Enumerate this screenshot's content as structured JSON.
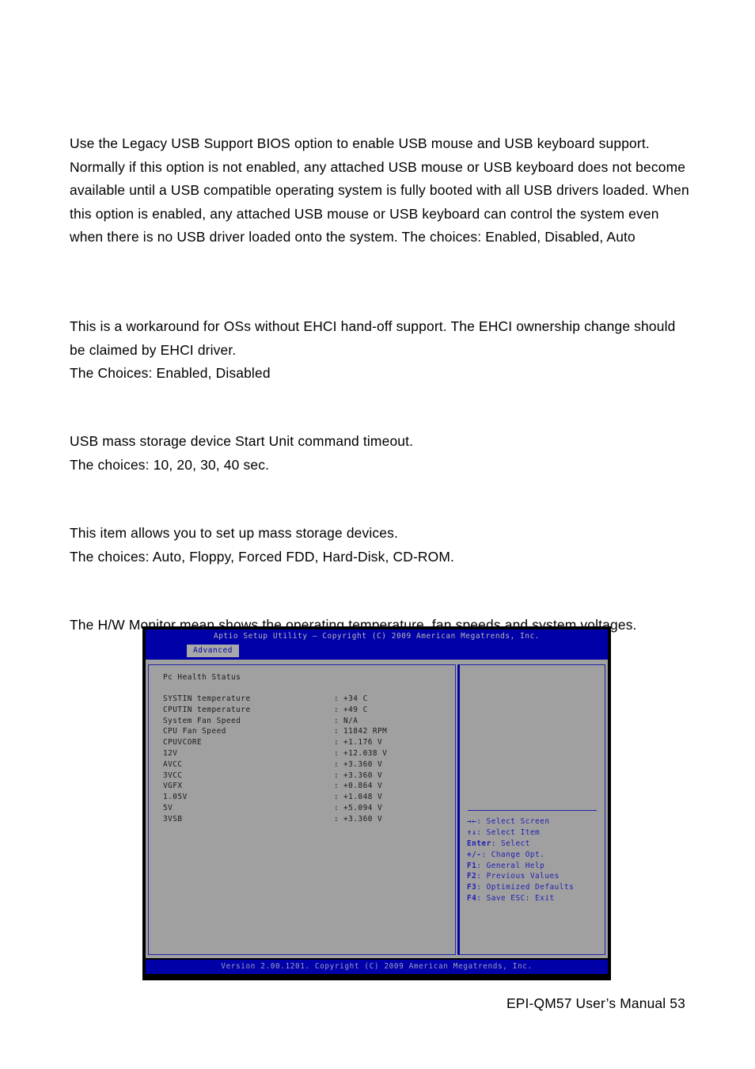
{
  "document": {
    "footer_text": "EPI-QM57  User’s  Manual 53",
    "page_number": "53"
  },
  "paragraphs": {
    "legacy_usb": "Use the Legacy USB Support BIOS option to enable USB mouse and USB keyboard support. Normally if this option is not enabled, any attached USB mouse or USB keyboard does not become available until a USB compatible operating system is fully booted with all USB drivers loaded. When this option is enabled, any attached USB mouse or USB keyboard can control the system even when there is no USB driver loaded onto the system. The choices: Enabled, Disabled, Auto",
    "ehci_handoff": "This is a workaround for OSs without EHCI hand-off support. The EHCI ownership change should be claimed by EHCI driver.\nThe Choices: Enabled, Disabled",
    "mass_storage_timeout": "USB mass storage device Start Unit command timeout.\nThe choices: 10, 20, 30, 40 sec.",
    "mass_storage_setup": "This item allows you to set up mass storage devices.\nThe choices: Auto, Floppy, Forced FDD, Hard-Disk, CD-ROM.",
    "hw_monitor": "The H/W Monitor mean shows the operating temperature, fan speeds and system voltages."
  },
  "bios": {
    "title": "Aptio Setup Utility – Copyright (C) 2009 American Megatrends, Inc.",
    "active_tab": "Advanced",
    "section_title": "Pc Health Status",
    "footer": "Version 2.00.1201. Copyright (C) 2009 American Megatrends, Inc.",
    "colors": {
      "header_blue": "#0000a8",
      "panel_gray": "#a0a0a0",
      "border_blue": "#2020a8",
      "help_text_blue": "#2020b4",
      "header_text": "#b9b9b9"
    },
    "items": [
      {
        "label": "SYSTIN temperature",
        "sep": ":",
        "value": "+34 C"
      },
      {
        "label": "CPUTIN temperature",
        "sep": ":",
        "value": "+49 C"
      },
      {
        "label": "System Fan Speed",
        "sep": ":",
        "value": "N/A"
      },
      {
        "label": "CPU Fan Speed",
        "sep": ":",
        "value": "11842 RPM"
      },
      {
        "label": "CPUVCORE",
        "sep": ":",
        "value": "+1.176 V"
      },
      {
        "label": "12V",
        "sep": ":",
        "value": "+12.038 V"
      },
      {
        "label": "AVCC",
        "sep": ":",
        "value": "+3.360 V"
      },
      {
        "label": "3VCC",
        "sep": ":",
        "value": "+3.360 V"
      },
      {
        "label": "VGFX",
        "sep": ":",
        "value": "+0.864 V"
      },
      {
        "label": "1.05V",
        "sep": ":",
        "value": "+1.048 V"
      },
      {
        "label": "5V",
        "sep": ":",
        "value": "+5.094 V"
      },
      {
        "label": "3VSB",
        "sep": ":",
        "value": "+3.360 V"
      }
    ],
    "help": [
      {
        "key": "→←",
        "text": ": Select Screen"
      },
      {
        "key": "↑↓",
        "text": ": Select Item"
      },
      {
        "key": "Enter",
        "text": ": Select"
      },
      {
        "key": "+/-",
        "text": ": Change Opt."
      },
      {
        "key": "F1",
        "text": ": General Help"
      },
      {
        "key": "F2",
        "text": ": Previous Values"
      },
      {
        "key": "F3",
        "text": ": Optimized Defaults"
      },
      {
        "key": "F4",
        "text": ": Save  ESC: Exit"
      }
    ]
  }
}
